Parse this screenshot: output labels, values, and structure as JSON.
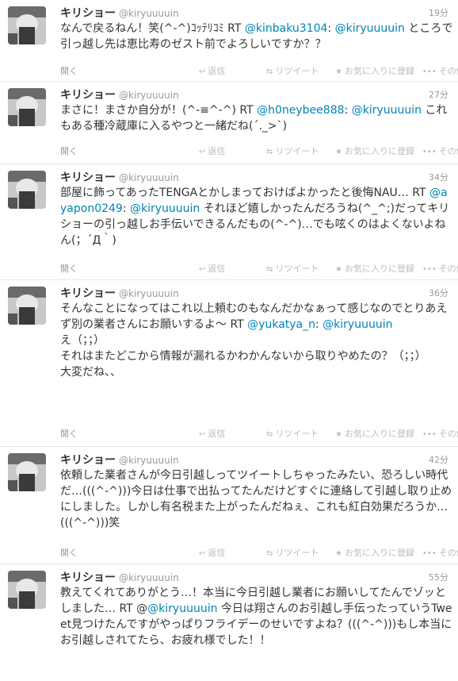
{
  "labels": {
    "open": "開く",
    "reply": "返信",
    "retweet": "リツイート",
    "favorite": "お気に入りに登録",
    "more": "その他"
  },
  "tweets": [
    {
      "name": "キリショー",
      "handle": "@kiryuuuuin",
      "time": "19分",
      "parts": [
        {
          "t": "なんで戻るねん！笑(^-^)ｺｯﾃﾘｺﾐ RT "
        },
        {
          "t": "@kinbaku3104",
          "m": true
        },
        {
          "t": ": "
        },
        {
          "t": "@kiryuuuuin",
          "m": true
        },
        {
          "t": " ところで引っ越し先は恵比寿のゼスト前でよろしいですか？？"
        }
      ]
    },
    {
      "name": "キリショー",
      "handle": "@kiryuuuuin",
      "time": "27分",
      "parts": [
        {
          "t": "まさに！まさか自分が！(^-≡^-^) RT "
        },
        {
          "t": "@h0neybee888",
          "m": true
        },
        {
          "t": ": "
        },
        {
          "t": "@kiryuuuuin",
          "m": true
        },
        {
          "t": " これもある種冷蔵庫に入るやつと一緒だね(´._>`)"
        }
      ]
    },
    {
      "name": "キリショー",
      "handle": "@kiryuuuuin",
      "time": "34分",
      "parts": [
        {
          "t": "部屋に飾ってあったTENGAとかしまっておけばよかったと後悔NAU… RT "
        },
        {
          "t": "@ayapon0249",
          "m": true
        },
        {
          "t": ": "
        },
        {
          "t": "@kiryuuuuin",
          "m": true
        },
        {
          "t": " それほど嬉しかったんだろうね(^_^;)だってキリショーの引っ越しお手伝いできるんだもの(^-^)…でも呟くのはよくないよねん(；´Д｀)"
        }
      ]
    },
    {
      "name": "キリショー",
      "handle": "@kiryuuuuin",
      "time": "36分",
      "parts": [
        {
          "t": "そんなことになってはこれ以上頼むのもなんだかなぁって感じなのでとりあえず別の業者さんにお願いするよ〜 RT "
        },
        {
          "t": "@yukatya_n",
          "m": true
        },
        {
          "t": ": "
        },
        {
          "t": "@kiryuuuuin",
          "m": true
        },
        {
          "t": "\nえ（；；）\nそれはまたどこから情報が漏れるかわかんないから取りやめたの？（；；）\n大変だね、、"
        }
      ]
    },
    {
      "name": "キリショー",
      "handle": "@kiryuuuuin",
      "time": "42分",
      "parts": [
        {
          "t": "依頼した業者さんが今日引越しってツイートしちゃったみたい、恐ろしい時代だ…(((^-^)))今日は仕事で出払ってたんだけどすぐに連絡して引越し取り止めにしました。しかし有名税また上がったんだねぇ、これも紅白効果だろうか…(((^-^)))笑"
        }
      ]
    },
    {
      "name": "キリショー",
      "handle": "@kiryuuuuin",
      "time": "55分",
      "parts": [
        {
          "t": "教えてくれてありがとう…！本当に今日引越し業者にお願いしてたんでゾッとしました… RT @"
        },
        {
          "t": "@kiryuuuuin",
          "m": true
        },
        {
          "t": " 今日は翔さんのお引越し手伝ったっていうTweet見つけたんですがやっぱりフライデーのせいですよね？(((^-^)))もし本当にお引越しされてたら、お疲れ様でした！！"
        }
      ]
    }
  ]
}
